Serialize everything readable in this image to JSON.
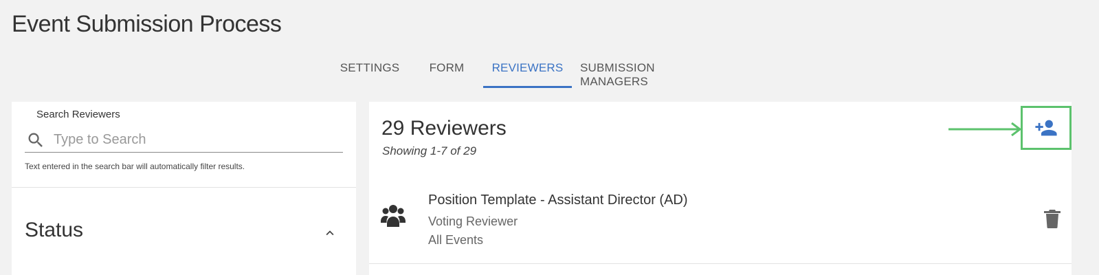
{
  "page": {
    "title": "Event Submission Process"
  },
  "tabs": [
    {
      "label": "SETTINGS",
      "active": false
    },
    {
      "label": "FORM",
      "active": false
    },
    {
      "label": "REVIEWERS",
      "active": true
    },
    {
      "label": "SUBMISSION MANAGERS",
      "active": false
    }
  ],
  "search": {
    "label": "Search Reviewers",
    "placeholder": "Type to Search",
    "value": "",
    "help": "Text entered in the search bar will automatically filter results.",
    "icon": "search-icon"
  },
  "filters": {
    "status_title": "Status",
    "status_expanded": true
  },
  "reviewers": {
    "count_title": "29 Reviewers",
    "showing": "Showing 1-7 of 29",
    "add_icon": "add-person-icon",
    "highlight_color": "#5cc26d",
    "items": [
      {
        "name": "Position Template - Assistant Director (AD)",
        "role": "Voting Reviewer",
        "scope": "All Events",
        "icon": "group-icon"
      }
    ]
  },
  "colors": {
    "accent": "#3b73c4",
    "highlight": "#5cc26d",
    "background": "#f2f2f2"
  }
}
